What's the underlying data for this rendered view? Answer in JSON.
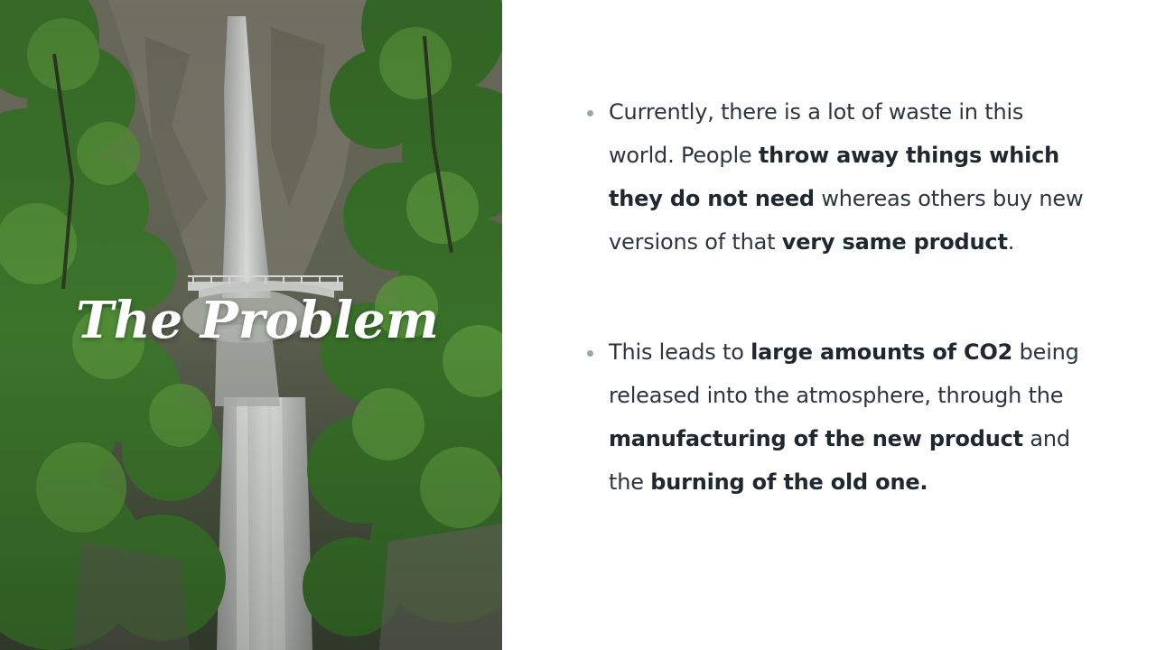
{
  "slide": {
    "title": "The Problem",
    "image_alt": "waterfall",
    "accent_color": "#9aa9a6",
    "text_color": "#2d3540"
  },
  "bullets": [
    {
      "segments": [
        {
          "text": "Currently, there is a lot of waste in this world. People ",
          "bold": false
        },
        {
          "text": "throw away things which they do not need",
          "bold": true
        },
        {
          "text": " whereas others buy new versions of that ",
          "bold": false
        },
        {
          "text": "very same product",
          "bold": true
        },
        {
          "text": ".",
          "bold": false
        }
      ]
    },
    {
      "segments": [
        {
          "text": "This leads to ",
          "bold": false
        },
        {
          "text": "large amounts of CO2",
          "bold": true
        },
        {
          "text": " being released into the atmosphere, through the ",
          "bold": false
        },
        {
          "text": "manufacturing of the new product",
          "bold": true
        },
        {
          "text": " and the ",
          "bold": false
        },
        {
          "text": "burning of the old one.",
          "bold": true
        }
      ]
    }
  ]
}
